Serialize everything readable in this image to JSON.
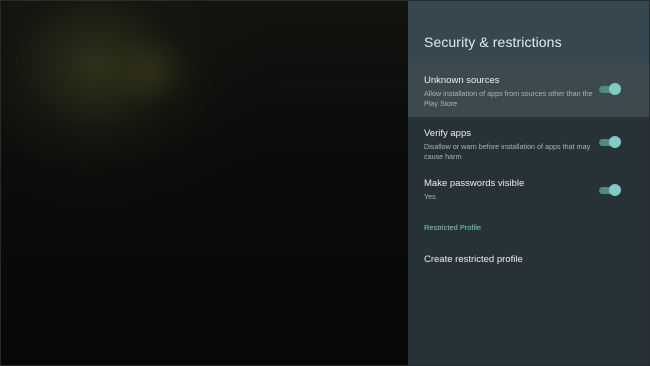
{
  "panel": {
    "title": "Security & restrictions",
    "settings": [
      {
        "title": "Unknown sources",
        "subtitle": "Allow installation of apps from sources other than the Play Store",
        "toggle_on": true,
        "focused": true
      },
      {
        "title": "Verify apps",
        "subtitle": "Disallow or warn before installation of apps that may cause harm",
        "toggle_on": true,
        "focused": false
      },
      {
        "title": "Make passwords visible",
        "subtitle": "Yes",
        "toggle_on": true,
        "focused": false
      }
    ],
    "section_label": "Restricted Profile",
    "action": "Create restricted profile"
  },
  "colors": {
    "panel_bg": "#263238",
    "header_bg": "#37474f",
    "accent": "#80cbc4",
    "toggle_track": "#4e8c7c"
  },
  "icons": {
    "toggle": "switch-on"
  }
}
